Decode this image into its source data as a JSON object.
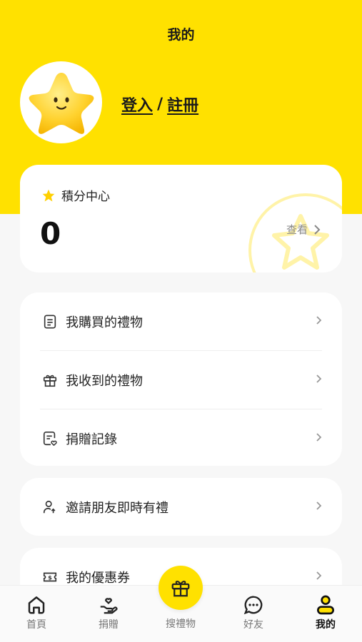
{
  "header": {
    "title": "我的"
  },
  "auth": {
    "login": "登入",
    "separator": "/",
    "register": "註冊"
  },
  "points": {
    "title": "積分中心",
    "value": "0",
    "view_label": "查看"
  },
  "menu_group1": [
    {
      "label": "我購買的禮物",
      "icon": "receipt-icon"
    },
    {
      "label": "我收到的禮物",
      "icon": "gift-icon"
    },
    {
      "label": "捐贈記錄",
      "icon": "donation-record-icon"
    }
  ],
  "menu_group2": [
    {
      "label": "邀請朋友即時有禮",
      "icon": "invite-friend-icon"
    }
  ],
  "menu_group3": [
    {
      "label": "我的優惠券",
      "icon": "coupon-icon"
    }
  ],
  "nav": {
    "home": "首頁",
    "donate": "捐贈",
    "search_gifts": "搜禮物",
    "friends": "好友",
    "mine": "我的"
  },
  "colors": {
    "brand_yellow": "#ffe100"
  }
}
